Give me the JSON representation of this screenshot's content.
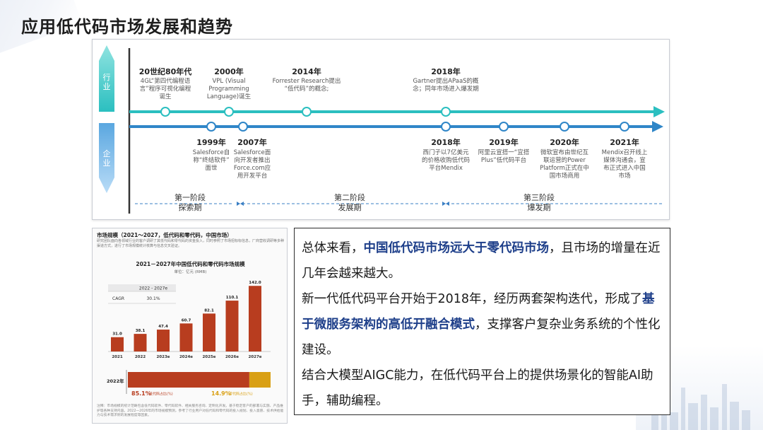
{
  "page": {
    "title": "应用低代码市场发展和趋势"
  },
  "timeline": {
    "industry_label": "行业",
    "enterprise_label": "企业",
    "industry_events": [
      {
        "year": "20世纪80年代",
        "desc": [
          "4GL“第四代编程语",
          "言”程序可视化编程",
          "诞生"
        ]
      },
      {
        "year": "2000年",
        "desc": [
          "VPL (Visual",
          "Programming",
          "Language)诞生"
        ]
      },
      {
        "year": "2014年",
        "desc": [
          "Forrester Research提出",
          "“低代码”的概念;"
        ]
      },
      {
        "year": "2018年",
        "desc": [
          "Gartner提出APaaS的概",
          "念；同年市场进入爆发期"
        ]
      }
    ],
    "enterprise_events": [
      {
        "year": "1999年",
        "desc": [
          "Salesforce自",
          "称“终结软件”",
          "面世"
        ]
      },
      {
        "year": "2007年",
        "desc": [
          "Salesforce面",
          "向开发者推出",
          "Force.com应",
          "用开发平台"
        ]
      },
      {
        "year": "2018年",
        "desc": [
          "西门子以7亿美元",
          "的价格收购低代码",
          "平台Mendix"
        ]
      },
      {
        "year": "2019年",
        "desc": [
          "阿里云宣搭一“宜搭",
          "Plus”低代码平台"
        ]
      },
      {
        "year": "2020年",
        "desc": [
          "微软宣布由世纪互",
          "联运营的Power",
          "Platform正式在中",
          "国市场商用"
        ]
      },
      {
        "year": "2021年",
        "desc": [
          "Mendix召开线上",
          "媒体沟通会，宣",
          "布正式进入中国",
          "市场"
        ]
      }
    ],
    "stages": [
      {
        "name": "第一阶段",
        "sub": "探索期"
      },
      {
        "name": "第二阶段",
        "sub": "发展期"
      },
      {
        "name": "第三阶段",
        "sub": "爆发期"
      }
    ]
  },
  "figure": {
    "section_title": "市场规模（2021～2027，低代码和零代码，中国市场）",
    "intro": "研究团队面向各领域行业的客户调研了其低代码和零代码的资金投入，同时参照了市场招标标信息，厂商营收调研等多种渠道方式，进行了市场规模统计核算与信息交叉验证。",
    "chart_title": "2021－2027年中国低代码和零代码市场规模",
    "unit": "单位：亿元 (RMB)",
    "cagr_period": "2022 - 2027e",
    "cagr_label": "CAGR",
    "cagr_value": "30.1%",
    "bar_year_label": "2022年",
    "low_code_share": "85.1%",
    "low_code_label": "低代码占比(%)",
    "no_code_share": "14.9%",
    "no_code_label": "零代码占比(%)",
    "note": "注释：市场规模的统计范畴包含低代码软件、零代码软件、相关服务咨询、定制化开发。基于稳定客户的部署与实施、产品维护等各种支持内容。2022—2026年的市场规模预测，参考了行业用户对低代码和零代码的投入规划、投入意愿、技术供给能力与技术需求侧的发展程度等因素。"
  },
  "chart_data": {
    "type": "bar",
    "title": "2021－2027年中国低代码和零代码市场规模",
    "ylabel": "单位：亿元 (RMB)",
    "categories": [
      "2021",
      "2022",
      "2023e",
      "2024e",
      "2025e",
      "2026e",
      "2027e"
    ],
    "values": [
      31.0,
      38.1,
      47.4,
      60.7,
      82.1,
      110.1,
      142.0
    ],
    "ylim": [
      0,
      150
    ],
    "color": "#b83d1f",
    "share_2022": {
      "low_code_pct": 85.1,
      "no_code_pct": 14.9,
      "low_code_color": "#b83d1f",
      "no_code_color": "#d9a014"
    }
  },
  "summary": {
    "p1_a": "总体来看，",
    "p1_hl": "中国低代码市场远大于零代码市场",
    "p1_b": "，且市场的增量在近几年会越来越大。",
    "p2_a": "新一代低代码平台开始于2018年，经历两套架构迭代，形成了",
    "p2_hl": "基于微服务架构的高低开融合模式",
    "p2_b": "，支撑客户复杂业务系统的个性化建设。",
    "p3": "结合大模型AIGC能力，在低代码平台上的提供场景化的智能AI助手，辅助编程。"
  },
  "colors": {
    "teal": "#2bbfc0",
    "blue": "#2f86c8",
    "highlight": "#1e3f8a"
  }
}
